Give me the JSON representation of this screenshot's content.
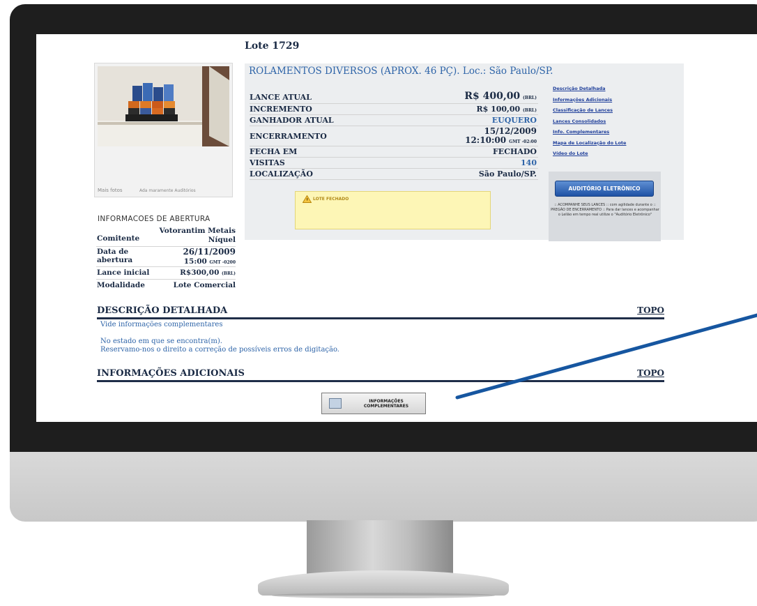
{
  "lote": {
    "title": "Lote 1729"
  },
  "photo": {
    "more_photos": "Mais fotos",
    "caption": "Ada maramente Auditórios"
  },
  "product": {
    "title": "ROLAMENTOS DIVERSOS (APROX. 46 PÇ). Loc.: São Paulo/SP."
  },
  "info": {
    "lance_atual": {
      "label": "LANCE ATUAL",
      "value": "R$ 400,00",
      "unit": "(BRL)"
    },
    "incremento": {
      "label": "INCREMENTO",
      "value": "R$ 100,00",
      "unit": "(BRL)"
    },
    "ganhador": {
      "label": "GANHADOR ATUAL",
      "value": "EUQUERO"
    },
    "encerramento": {
      "label": "ENCERRAMENTO",
      "date": "15/12/2009",
      "time": "12:10:00",
      "tz": "GMT -02:00"
    },
    "fecha_em": {
      "label": "FECHA EM",
      "value": "FECHADO"
    },
    "visitas": {
      "label": "VISITAS",
      "value": "140"
    },
    "localizacao": {
      "label": "LOCALIZAÇÃO",
      "value": "São Paulo/SP."
    }
  },
  "alert": {
    "text": "LOTE FECHADO"
  },
  "side_links": [
    "Descrição Detalhada",
    "Informações Adicionais",
    "Classificação de Lances",
    "Lances Consolidados",
    "Info. Complementares",
    "Mapa de Localização do Lote",
    "Vídeo do Lote"
  ],
  "auditorio": {
    "button": "AUDITÓRIO ELETRÔNICO",
    "note": ":: ACOMPANHE SEUS LANCES :: com agilidade durante o :: PREGÃO DE ENCERRAMENTO :: Para dar lances e acompanhar o Leilão em tempo real utilize o \"Auditório Eletrônico\""
  },
  "opening": {
    "title": "INFORMACOES DE ABERTURA",
    "comitente": {
      "label": "Comitente",
      "value_line1": "Votorantim Metais",
      "value_line2": "Níquel"
    },
    "data": {
      "label_line1": "Data de",
      "label_line2": "abertura",
      "date": "26/11/2009",
      "time": "15:00",
      "tz": "GMT -0200"
    },
    "lance_inicial": {
      "label": "Lance inicial",
      "value": "R$300,00",
      "unit": "(BRL)"
    },
    "modalidade": {
      "label": "Modalidade",
      "value": "Lote Comercial"
    }
  },
  "sections": {
    "descricao": {
      "title": "DESCRIÇÃO DETALHADA",
      "topo": "TOPO"
    },
    "adicionais": {
      "title": "INFORMAÇÕES ADICIONAIS",
      "topo": "TOPO"
    }
  },
  "description": {
    "line1": "Vide informações complementares",
    "line2": "No estado em que se encontra(m).",
    "line3": "Reservamo-nos o direito a correção de possíveis erros de digitação."
  },
  "info_button": {
    "line1": "INFORMAÇÕES",
    "line2": "COMPLEMENTARES"
  },
  "colors": {
    "link_blue": "#2e64a8",
    "navy": "#1a2a44",
    "pointer": "#1656a0",
    "alert_bg": "#fdf6b6"
  }
}
